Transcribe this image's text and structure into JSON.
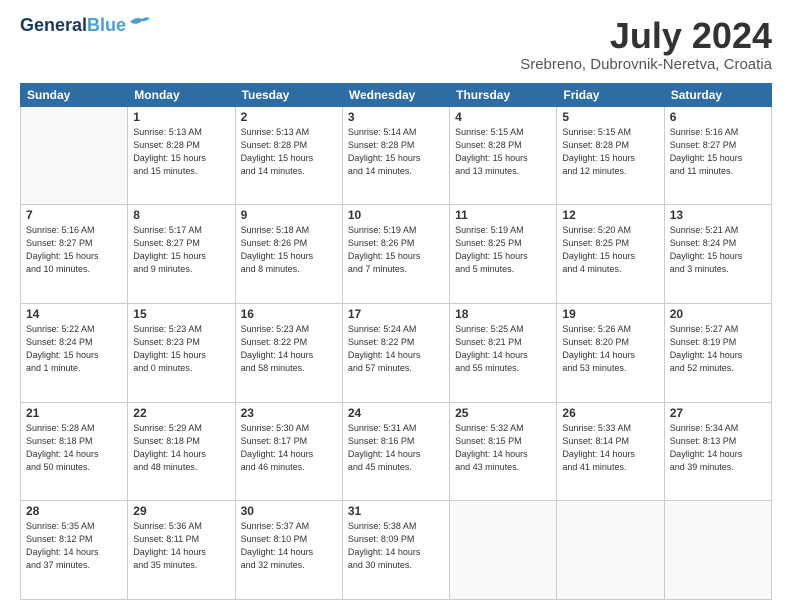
{
  "logo": {
    "line1": "General",
    "line2": "Blue"
  },
  "title": "July 2024",
  "location": "Srebreno, Dubrovnik-Neretva, Croatia",
  "days_header": [
    "Sunday",
    "Monday",
    "Tuesday",
    "Wednesday",
    "Thursday",
    "Friday",
    "Saturday"
  ],
  "weeks": [
    [
      {
        "day": "",
        "info": ""
      },
      {
        "day": "1",
        "info": "Sunrise: 5:13 AM\nSunset: 8:28 PM\nDaylight: 15 hours\nand 15 minutes."
      },
      {
        "day": "2",
        "info": "Sunrise: 5:13 AM\nSunset: 8:28 PM\nDaylight: 15 hours\nand 14 minutes."
      },
      {
        "day": "3",
        "info": "Sunrise: 5:14 AM\nSunset: 8:28 PM\nDaylight: 15 hours\nand 14 minutes."
      },
      {
        "day": "4",
        "info": "Sunrise: 5:15 AM\nSunset: 8:28 PM\nDaylight: 15 hours\nand 13 minutes."
      },
      {
        "day": "5",
        "info": "Sunrise: 5:15 AM\nSunset: 8:28 PM\nDaylight: 15 hours\nand 12 minutes."
      },
      {
        "day": "6",
        "info": "Sunrise: 5:16 AM\nSunset: 8:27 PM\nDaylight: 15 hours\nand 11 minutes."
      }
    ],
    [
      {
        "day": "7",
        "info": "Sunrise: 5:16 AM\nSunset: 8:27 PM\nDaylight: 15 hours\nand 10 minutes."
      },
      {
        "day": "8",
        "info": "Sunrise: 5:17 AM\nSunset: 8:27 PM\nDaylight: 15 hours\nand 9 minutes."
      },
      {
        "day": "9",
        "info": "Sunrise: 5:18 AM\nSunset: 8:26 PM\nDaylight: 15 hours\nand 8 minutes."
      },
      {
        "day": "10",
        "info": "Sunrise: 5:19 AM\nSunset: 8:26 PM\nDaylight: 15 hours\nand 7 minutes."
      },
      {
        "day": "11",
        "info": "Sunrise: 5:19 AM\nSunset: 8:25 PM\nDaylight: 15 hours\nand 5 minutes."
      },
      {
        "day": "12",
        "info": "Sunrise: 5:20 AM\nSunset: 8:25 PM\nDaylight: 15 hours\nand 4 minutes."
      },
      {
        "day": "13",
        "info": "Sunrise: 5:21 AM\nSunset: 8:24 PM\nDaylight: 15 hours\nand 3 minutes."
      }
    ],
    [
      {
        "day": "14",
        "info": "Sunrise: 5:22 AM\nSunset: 8:24 PM\nDaylight: 15 hours\nand 1 minute."
      },
      {
        "day": "15",
        "info": "Sunrise: 5:23 AM\nSunset: 8:23 PM\nDaylight: 15 hours\nand 0 minutes."
      },
      {
        "day": "16",
        "info": "Sunrise: 5:23 AM\nSunset: 8:22 PM\nDaylight: 14 hours\nand 58 minutes."
      },
      {
        "day": "17",
        "info": "Sunrise: 5:24 AM\nSunset: 8:22 PM\nDaylight: 14 hours\nand 57 minutes."
      },
      {
        "day": "18",
        "info": "Sunrise: 5:25 AM\nSunset: 8:21 PM\nDaylight: 14 hours\nand 55 minutes."
      },
      {
        "day": "19",
        "info": "Sunrise: 5:26 AM\nSunset: 8:20 PM\nDaylight: 14 hours\nand 53 minutes."
      },
      {
        "day": "20",
        "info": "Sunrise: 5:27 AM\nSunset: 8:19 PM\nDaylight: 14 hours\nand 52 minutes."
      }
    ],
    [
      {
        "day": "21",
        "info": "Sunrise: 5:28 AM\nSunset: 8:18 PM\nDaylight: 14 hours\nand 50 minutes."
      },
      {
        "day": "22",
        "info": "Sunrise: 5:29 AM\nSunset: 8:18 PM\nDaylight: 14 hours\nand 48 minutes."
      },
      {
        "day": "23",
        "info": "Sunrise: 5:30 AM\nSunset: 8:17 PM\nDaylight: 14 hours\nand 46 minutes."
      },
      {
        "day": "24",
        "info": "Sunrise: 5:31 AM\nSunset: 8:16 PM\nDaylight: 14 hours\nand 45 minutes."
      },
      {
        "day": "25",
        "info": "Sunrise: 5:32 AM\nSunset: 8:15 PM\nDaylight: 14 hours\nand 43 minutes."
      },
      {
        "day": "26",
        "info": "Sunrise: 5:33 AM\nSunset: 8:14 PM\nDaylight: 14 hours\nand 41 minutes."
      },
      {
        "day": "27",
        "info": "Sunrise: 5:34 AM\nSunset: 8:13 PM\nDaylight: 14 hours\nand 39 minutes."
      }
    ],
    [
      {
        "day": "28",
        "info": "Sunrise: 5:35 AM\nSunset: 8:12 PM\nDaylight: 14 hours\nand 37 minutes."
      },
      {
        "day": "29",
        "info": "Sunrise: 5:36 AM\nSunset: 8:11 PM\nDaylight: 14 hours\nand 35 minutes."
      },
      {
        "day": "30",
        "info": "Sunrise: 5:37 AM\nSunset: 8:10 PM\nDaylight: 14 hours\nand 32 minutes."
      },
      {
        "day": "31",
        "info": "Sunrise: 5:38 AM\nSunset: 8:09 PM\nDaylight: 14 hours\nand 30 minutes."
      },
      {
        "day": "",
        "info": ""
      },
      {
        "day": "",
        "info": ""
      },
      {
        "day": "",
        "info": ""
      }
    ]
  ]
}
